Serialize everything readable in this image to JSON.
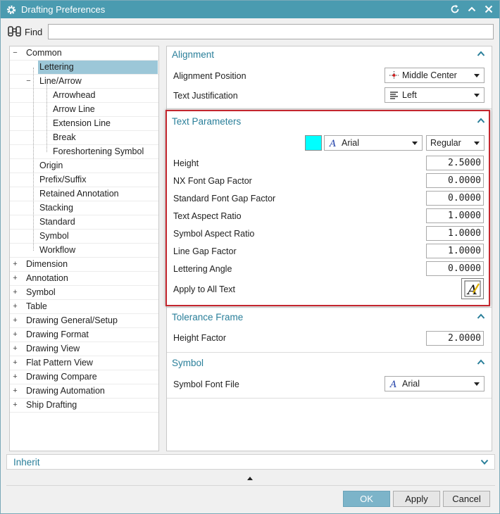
{
  "window": {
    "title": "Drafting Preferences"
  },
  "find": {
    "label": "Find",
    "value": ""
  },
  "tree": {
    "items": [
      {
        "label": "Common",
        "level": 0,
        "expander": "−"
      },
      {
        "label": "Lettering",
        "level": 1,
        "expander": "",
        "selected": true
      },
      {
        "label": "Line/Arrow",
        "level": 1,
        "expander": "−"
      },
      {
        "label": "Arrowhead",
        "level": 2,
        "expander": ""
      },
      {
        "label": "Arrow Line",
        "level": 2,
        "expander": ""
      },
      {
        "label": "Extension Line",
        "level": 2,
        "expander": ""
      },
      {
        "label": "Break",
        "level": 2,
        "expander": ""
      },
      {
        "label": "Foreshortening Symbol",
        "level": 2,
        "expander": ""
      },
      {
        "label": "Origin",
        "level": 1,
        "expander": ""
      },
      {
        "label": "Prefix/Suffix",
        "level": 1,
        "expander": ""
      },
      {
        "label": "Retained Annotation",
        "level": 1,
        "expander": ""
      },
      {
        "label": "Stacking",
        "level": 1,
        "expander": ""
      },
      {
        "label": "Standard",
        "level": 1,
        "expander": ""
      },
      {
        "label": "Symbol",
        "level": 1,
        "expander": ""
      },
      {
        "label": "Workflow",
        "level": 1,
        "expander": ""
      },
      {
        "label": "Dimension",
        "level": 0,
        "expander": "+"
      },
      {
        "label": "Annotation",
        "level": 0,
        "expander": "+"
      },
      {
        "label": "Symbol",
        "level": 0,
        "expander": "+"
      },
      {
        "label": "Table",
        "level": 0,
        "expander": "+"
      },
      {
        "label": "Drawing General/Setup",
        "level": 0,
        "expander": "+"
      },
      {
        "label": "Drawing Format",
        "level": 0,
        "expander": "+"
      },
      {
        "label": "Drawing View",
        "level": 0,
        "expander": "+"
      },
      {
        "label": "Flat Pattern View",
        "level": 0,
        "expander": "+"
      },
      {
        "label": "Drawing Compare",
        "level": 0,
        "expander": "+"
      },
      {
        "label": "Drawing Automation",
        "level": 0,
        "expander": "+"
      },
      {
        "label": "Ship Drafting",
        "level": 0,
        "expander": "+"
      }
    ]
  },
  "alignment": {
    "title": "Alignment",
    "position_label": "Alignment Position",
    "position_value": "Middle Center",
    "justification_label": "Text Justification",
    "justification_value": "Left"
  },
  "text_parameters": {
    "title": "Text Parameters",
    "color": "#00ffff",
    "font": "Arial",
    "style": "Regular",
    "fields": [
      {
        "label": "Height",
        "value": "2.5000"
      },
      {
        "label": "NX Font Gap Factor",
        "value": "0.0000"
      },
      {
        "label": "Standard Font Gap Factor",
        "value": "0.0000"
      },
      {
        "label": "Text Aspect Ratio",
        "value": "1.0000"
      },
      {
        "label": "Symbol Aspect Ratio",
        "value": "1.0000"
      },
      {
        "label": "Line Gap Factor",
        "value": "1.0000"
      },
      {
        "label": "Lettering Angle",
        "value": "0.0000"
      }
    ],
    "apply_label": "Apply to All Text"
  },
  "tolerance_frame": {
    "title": "Tolerance Frame",
    "height_factor_label": "Height Factor",
    "height_factor_value": "2.0000"
  },
  "symbol": {
    "title": "Symbol",
    "font_file_label": "Symbol Font File",
    "font_file_value": "Arial"
  },
  "inherit": {
    "label": "Inherit"
  },
  "buttons": {
    "ok": "OK",
    "apply": "Apply",
    "cancel": "Cancel"
  },
  "colors": {
    "titlebar": "#4a9bb0",
    "accent_text": "#2a7f9a",
    "highlight": "#c4262e",
    "selection": "#9cc7d8",
    "ok_button": "#7cb4c9"
  }
}
